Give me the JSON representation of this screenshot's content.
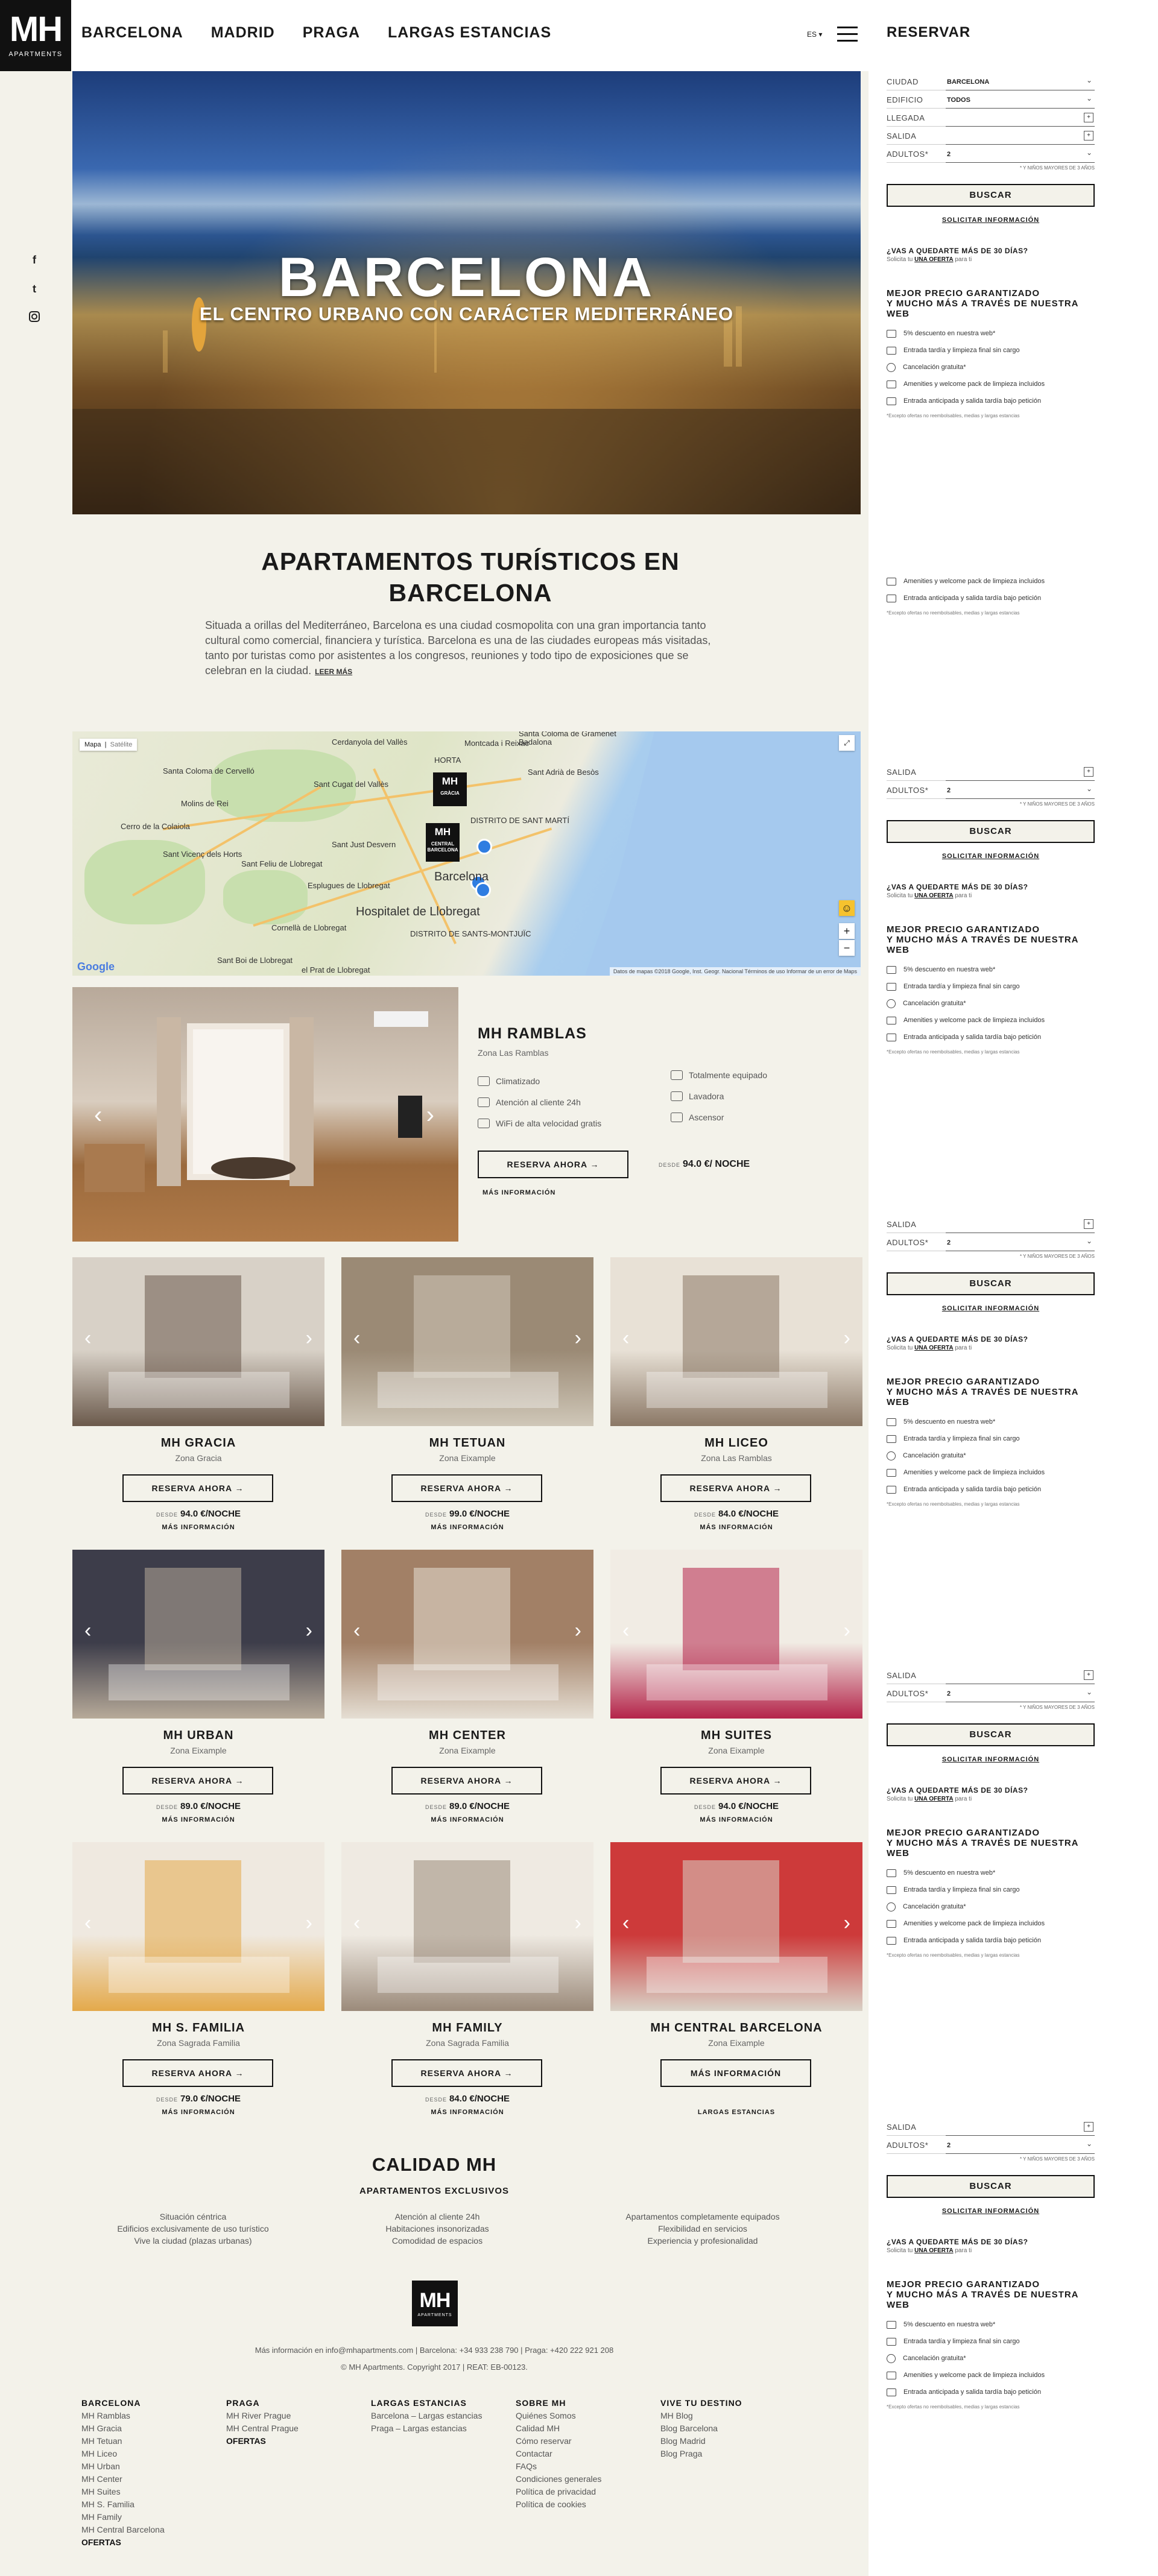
{
  "header": {
    "logo": "MH",
    "logo_sub": "APARTMENTS",
    "nav": [
      "BARCELONA",
      "MADRID",
      "PRAGA",
      "LARGAS ESTANCIAS"
    ],
    "lang": "ES ▾"
  },
  "hero": {
    "title": "BARCELONA",
    "subtitle": "EL CENTRO URBANO CON CARÁCTER MEDITERRÁNEO"
  },
  "intro": {
    "title": "APARTAMENTOS TURÍSTICOS EN BARCELONA",
    "text": "Situada a orillas del Mediterráneo, Barcelona es una ciudad cosmopolita con una gran importancia tanto cultural como comercial, financiera y turística. Barcelona es una de las ciudades europeas más visitadas, tanto por turistas como por asistentes a los congresos, reuniones y todo tipo de exposiciones que se celebran en la ciudad.",
    "more": "LEER MÁS"
  },
  "map": {
    "tab_map": "Mapa",
    "tab_sat": "Satélite",
    "pin1": "MH",
    "pin1_sub": "GRÀCIA",
    "pin2": "MH",
    "pin2_sub": "CENTRAL BARCELONA",
    "labels": [
      "Santa Coloma de Cervelló",
      "Sant Boi de Llobregat",
      "Cornellà de Llobregat",
      "Hospitalet de Llobregat",
      "Barcelona",
      "Badalona",
      "Sant Adrià de Besòs",
      "DISTRITO DE SANT MARTÍ",
      "DISTRITO DE SANTS-MONTJUÏC",
      "Esplugues de Llobregat",
      "Sant Feliu de Llobregat",
      "Molins de Rei",
      "Sant Vicenç dels Horts",
      "Santa Coloma de Gramenet",
      "HORTA",
      "Cerdanyola del Vallès",
      "Sant Cugat del Vallès",
      "Sant Just Desvern",
      "Montcada i Reixac",
      "el Prat de Llobregat",
      "Cerro de la Colaiola"
    ],
    "attr": "Datos de mapas ©2018 Google, Inst. Geogr. Nacional   Términos de uso   Informar de un error de Maps",
    "google": "Google",
    "zoom_in": "+",
    "zoom_out": "−"
  },
  "featured": {
    "title": "MH RAMBLAS",
    "zone": "Zona Las Ramblas",
    "amenities": [
      "Climatizado",
      "Atención al cliente 24h",
      "WiFi de alta velocidad gratis",
      "Totalmente equipado",
      "Lavadora",
      "Ascensor"
    ],
    "button": "RESERVA AHORA →",
    "price_prefix": "DESDE",
    "price": "94.0 €/ NOCHE",
    "more": "MÁS INFORMACIÓN"
  },
  "cards": [
    {
      "title": "MH GRACIA",
      "zone": "Zona Gracia",
      "button": "RESERVA AHORA →",
      "prefix": "DESDE",
      "price": "94.0 €/NOCHE",
      "more": "MÁS INFORMACIÓN"
    },
    {
      "title": "MH TETUAN",
      "zone": "Zona Eixample",
      "button": "RESERVA AHORA →",
      "prefix": "DESDE",
      "price": "99.0 €/NOCHE",
      "more": "MÁS INFORMACIÓN"
    },
    {
      "title": "MH LICEO",
      "zone": "Zona Las Ramblas",
      "button": "RESERVA AHORA →",
      "prefix": "DESDE",
      "price": "84.0 €/NOCHE",
      "more": "MÁS INFORMACIÓN"
    },
    {
      "title": "MH URBAN",
      "zone": "Zona Eixample",
      "button": "RESERVA AHORA →",
      "prefix": "DESDE",
      "price": "89.0 €/NOCHE",
      "more": "MÁS INFORMACIÓN"
    },
    {
      "title": "MH CENTER",
      "zone": "Zona Eixample",
      "button": "RESERVA AHORA →",
      "prefix": "DESDE",
      "price": "89.0 €/NOCHE",
      "more": "MÁS INFORMACIÓN"
    },
    {
      "title": "MH SUITES",
      "zone": "Zona Eixample",
      "button": "RESERVA AHORA →",
      "prefix": "DESDE",
      "price": "94.0 €/NOCHE",
      "more": "MÁS INFORMACIÓN"
    },
    {
      "title": "MH S. FAMILIA",
      "zone": "Zona Sagrada Familia",
      "button": "RESERVA AHORA →",
      "prefix": "DESDE",
      "price": "79.0 €/NOCHE",
      "more": "MÁS INFORMACIÓN"
    },
    {
      "title": "MH FAMILY",
      "zone": "Zona Sagrada Familia",
      "button": "RESERVA AHORA →",
      "prefix": "DESDE",
      "price": "84.0 €/NOCHE",
      "more": "MÁS INFORMACIÓN"
    },
    {
      "title": "MH CENTRAL BARCELONA",
      "zone": "Zona Eixample",
      "button": "MÁS INFORMACIÓN",
      "prefix": "",
      "price": "",
      "more": "LARGAS ESTANCIAS"
    }
  ],
  "calidad": {
    "title": "CALIDAD MH",
    "subtitle": "APARTAMENTOS EXCLUSIVOS",
    "col1": [
      "Situación céntrica",
      "Edificios exclusivamente de uso turístico",
      "Vive la ciudad (plazas urbanas)"
    ],
    "col2": [
      "Atención al cliente 24h",
      "Habitaciones insonorizadas",
      "Comodidad de espacios"
    ],
    "col3": [
      "Apartamentos completamente equipados",
      "Flexibilidad en servicios",
      "Experiencia y profesionalidad"
    ]
  },
  "footer": {
    "logo": "MH",
    "logo_sub": "APARTMENTS",
    "info": "Más información en info@mhapartments.com | Barcelona: +34 933 238 790 | Praga: +420 222 921 208",
    "copy": "© MH Apartments. Copyright 2017 | REAT: EB-00123.",
    "cols": [
      {
        "head": "BARCELONA",
        "items": [
          "MH Ramblas",
          "MH Gracia",
          "MH Tetuan",
          "MH Liceo",
          "MH Urban",
          "MH Center",
          "MH Suites",
          "MH S. Familia",
          "MH Family",
          "MH Central Barcelona"
        ],
        "bold": "OFERTAS"
      },
      {
        "head": "PRAGA",
        "items": [
          "MH River Prague",
          "MH Central Prague"
        ],
        "bold": "OFERTAS"
      },
      {
        "head": "LARGAS ESTANCIAS",
        "items": [
          "Barcelona – Largas estancias",
          "Praga – Largas estancias"
        ],
        "bold": ""
      },
      {
        "head": "SOBRE MH",
        "items": [
          "Quiénes Somos",
          "Calidad MH",
          "Cómo reservar",
          "Contactar",
          "FAQs",
          "Condiciones generales",
          "Política de privacidad",
          "Política de cookies"
        ],
        "bold": ""
      },
      {
        "head": "VIVE TU DESTINO",
        "items": [
          "MH Blog",
          "Blog Barcelona",
          "Blog Madrid",
          "Blog Praga"
        ],
        "bold": ""
      }
    ]
  },
  "sidebar": {
    "title": "RESERVAR",
    "ciudad_label": "CIUDAD",
    "ciudad": "BARCELONA",
    "edificio_label": "EDIFICIO",
    "edificio": "TODOS",
    "llegada_label": "LLEGADA",
    "salida_label": "SALIDA",
    "adultos_label": "ADULTOS*",
    "adultos": "2",
    "note": "* Y NIÑOS MAYORES DE 3 AÑOS",
    "buscar": "BUSCAR",
    "solicitar": "SOLICITAR INFORMACIÓN",
    "q": "¿VAS A QUEDARTE MÁS DE 30 DÍAS?",
    "q2a": "Solicita tu ",
    "q2b": "UNA OFERTA",
    "q2c": " para ti",
    "mp1": "MEJOR PRECIO GARANTIZADO",
    "mp2": "Y MUCHO MÁS A TRAVÉS DE NUESTRA WEB",
    "benefits": [
      "5% descuento en nuestra web*",
      "Entrada tardía y limpieza final sin cargo",
      "Cancelación gratuita*",
      "Amenities y welcome pack de limpieza incluidos",
      "Entrada anticipada y salida tardía bajo petición"
    ],
    "fnote": "*Excepto ofertas no reembolsables, medias y largas estancias"
  }
}
